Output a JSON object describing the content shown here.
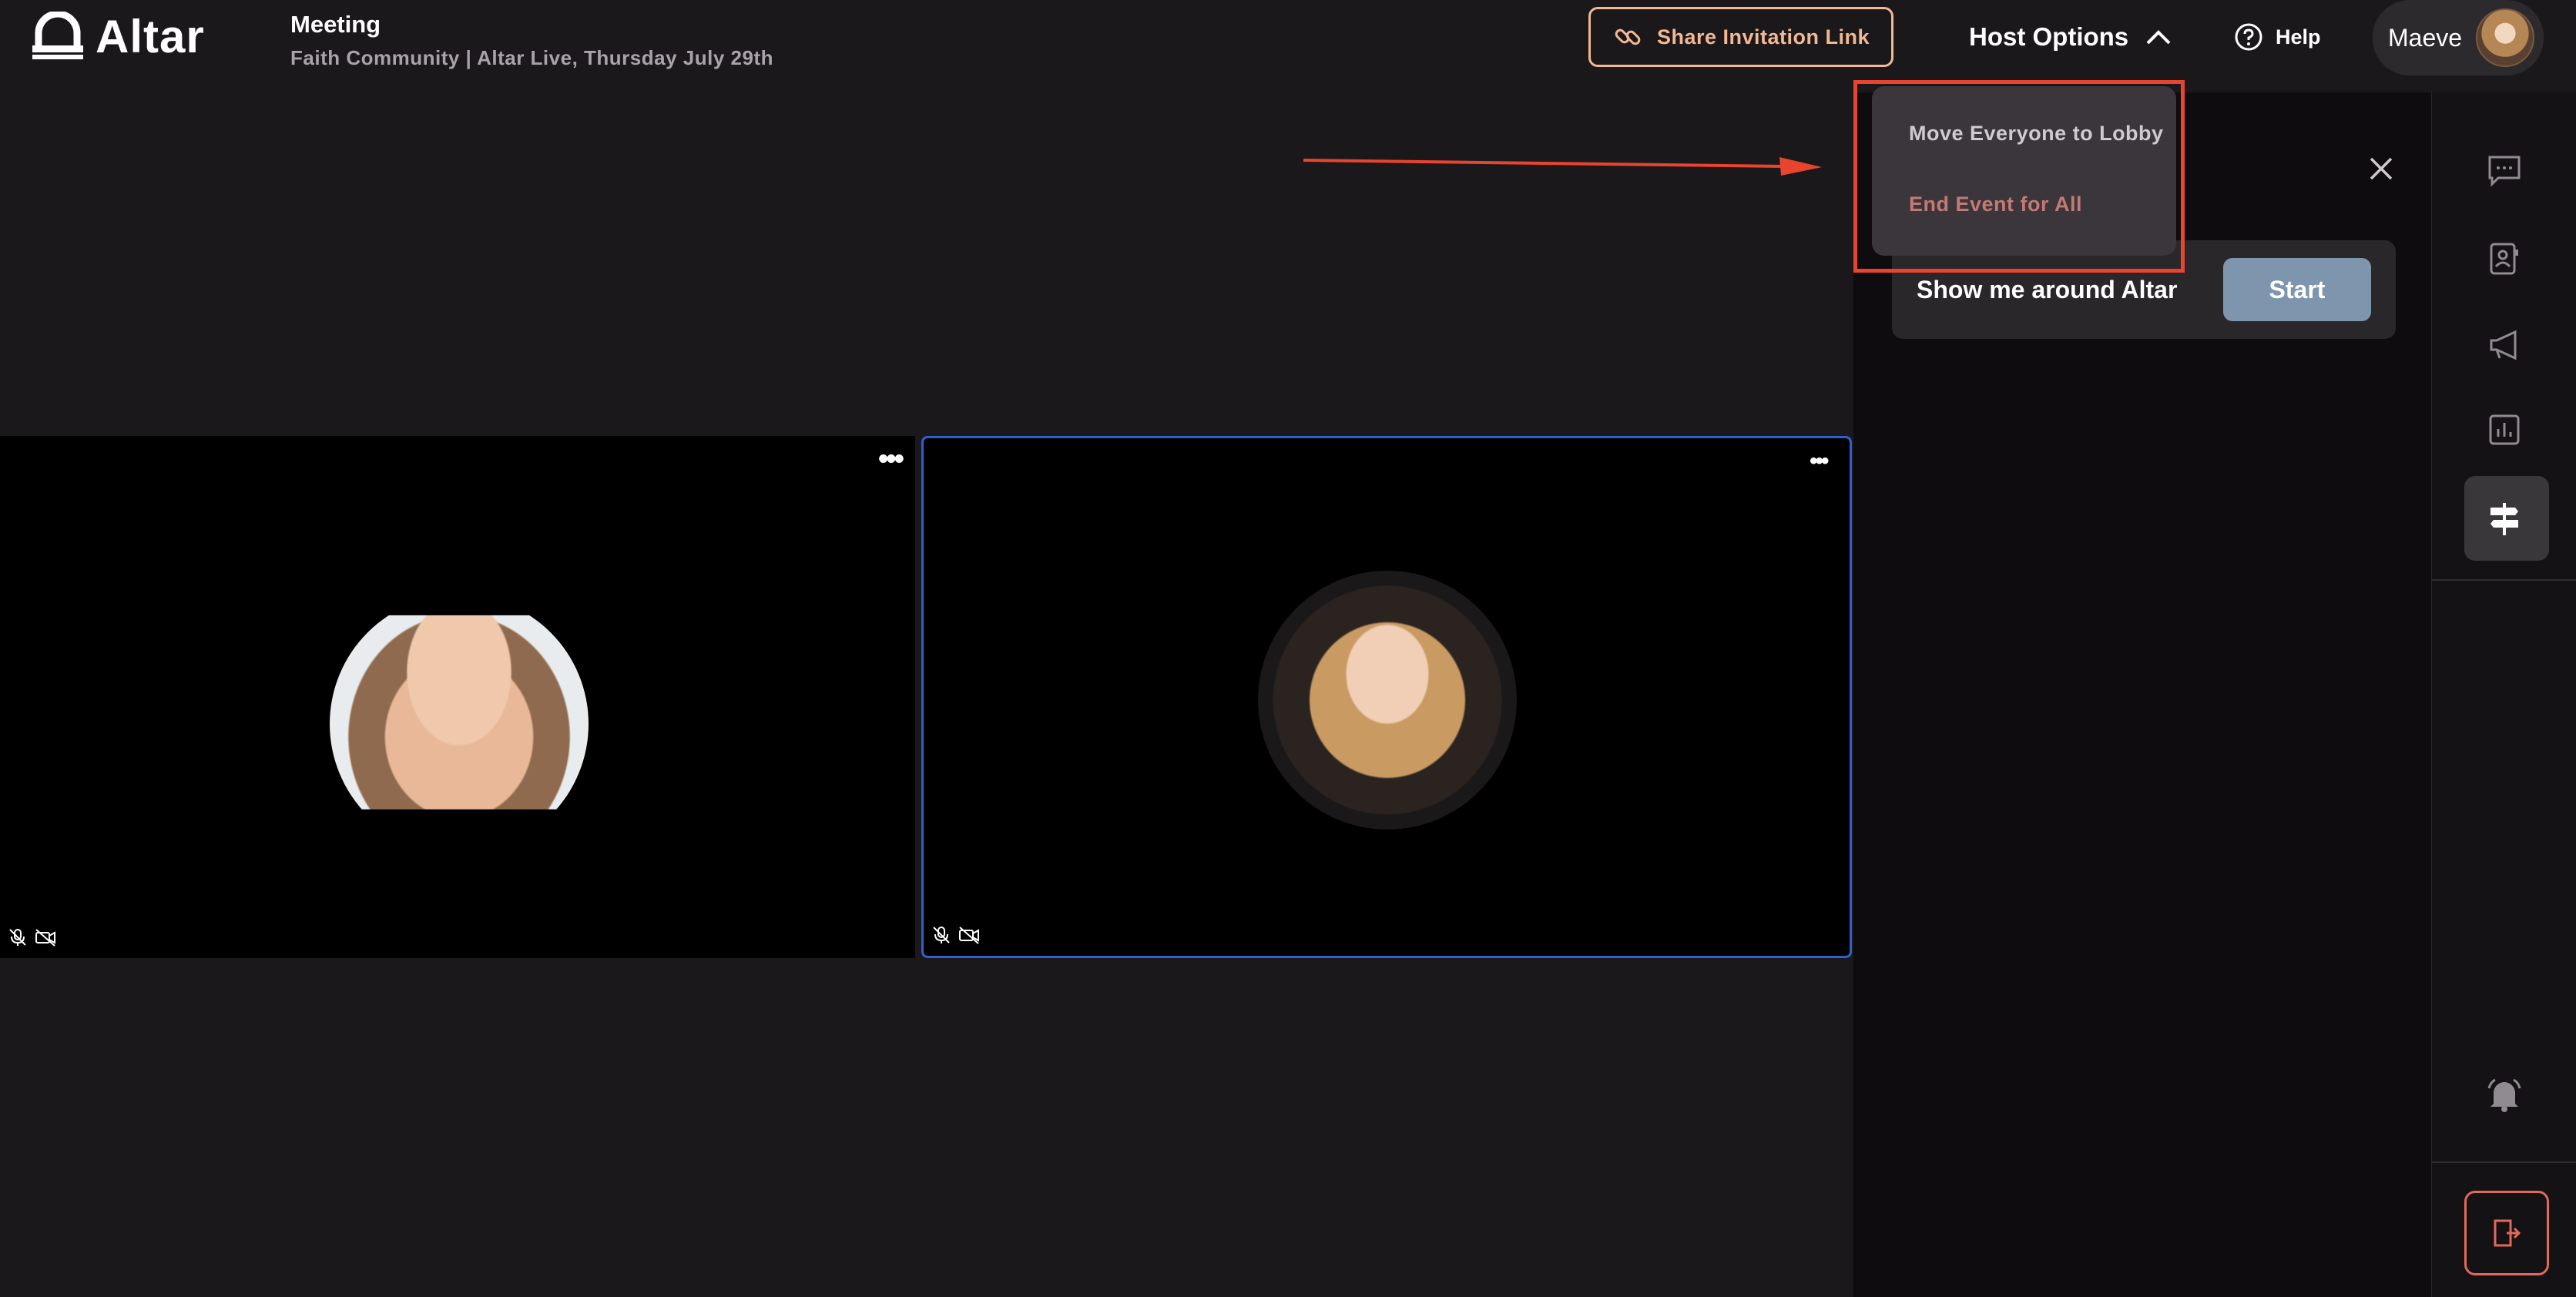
{
  "app": {
    "brand": "Altar"
  },
  "meeting": {
    "title": "Meeting",
    "subtitle": "Faith Community | Altar Live, Thursday July 29th"
  },
  "header": {
    "share_label": "Share Invitation Link",
    "host_options_label": "Host Options",
    "help_label": "Help",
    "user_name": "Maeve"
  },
  "host_menu": {
    "items": [
      {
        "label": "Move Everyone to Lobby"
      },
      {
        "label": "End Event for All"
      }
    ]
  },
  "tour": {
    "label": "Show me around Altar",
    "start_label": "Start"
  },
  "sidebar": {
    "icons": [
      "chat-icon",
      "contact-card-icon",
      "megaphone-icon",
      "poll-chart-icon",
      "signpost-icon",
      "bell-icon",
      "exit-icon"
    ],
    "active": "signpost-icon"
  },
  "tiles": [
    {
      "icons": [
        "mic-off-icon",
        "camera-off-icon"
      ]
    },
    {
      "icons": [
        "mic-off-icon",
        "camera-off-icon"
      ]
    }
  ],
  "colors": {
    "background": "#1b181b",
    "accent": "#f2b892",
    "start_button": "#7d96ad",
    "danger": "#c37a73",
    "highlight": "#e8442e",
    "active_tile_border": "#2f5fd0"
  }
}
